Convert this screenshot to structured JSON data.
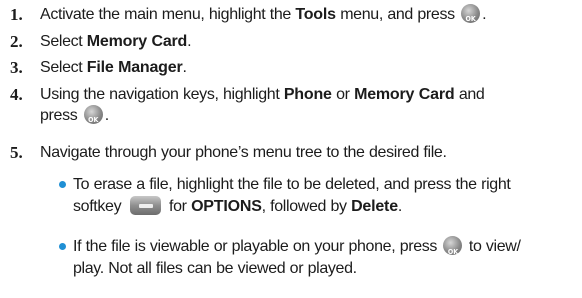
{
  "steps": [
    {
      "number": "1.",
      "parts": [
        "Activate the main menu, highlight the ",
        "Tools",
        " menu, and press ",
        "."
      ]
    },
    {
      "number": "2.",
      "parts": [
        "Select ",
        "Memory Card",
        "."
      ]
    },
    {
      "number": "3.",
      "parts": [
        "Select ",
        "File Manager",
        "."
      ]
    },
    {
      "number": "4.",
      "parts": [
        "Using the navigation keys, highlight ",
        "Phone",
        " or ",
        "Memory Card",
        " and",
        "press ",
        "."
      ]
    },
    {
      "number": "5.",
      "parts": [
        "Navigate through your phone’s menu tree to the desired file."
      ]
    }
  ],
  "bullets": [
    {
      "parts": [
        "To erase a file, highlight the file to be deleted, and press the right",
        "softkey ",
        " for ",
        "OPTIONS",
        ", followed by ",
        "Delete",
        "."
      ]
    },
    {
      "parts": [
        "If the file is viewable or playable on your phone, press ",
        " to view/",
        "play. Not all files can be viewed or played."
      ]
    }
  ],
  "icons": {
    "ok_key": "ok-button-icon",
    "softkey": "right-softkey-icon",
    "bullet_color": "#1f8fd4"
  }
}
